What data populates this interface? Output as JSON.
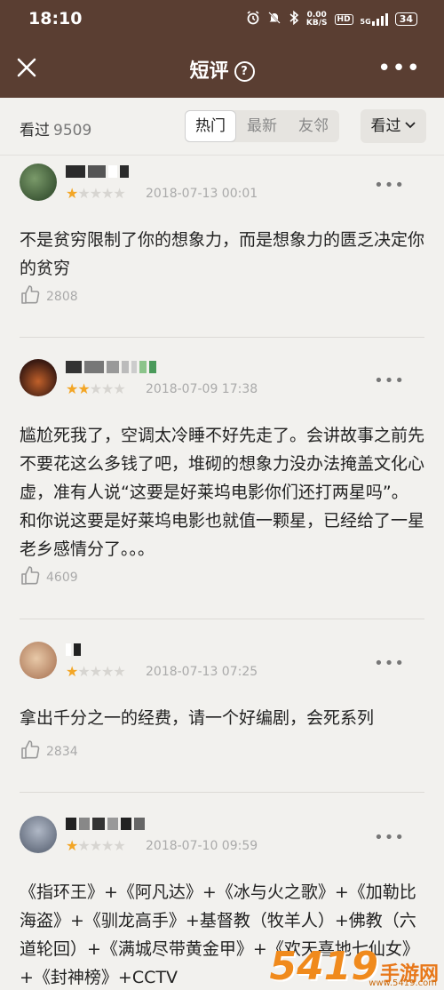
{
  "status_bar": {
    "time": "18:10",
    "speed_value": "0.00",
    "speed_unit": "KB/S",
    "hd": "HD",
    "network": "5G",
    "battery": "34"
  },
  "header": {
    "title": "短评",
    "help_icon": "question-circle-icon",
    "close_icon": "close-icon",
    "more_icon": "more-horizontal-icon",
    "more_glyph": "•••"
  },
  "filter_bar": {
    "seen_label": "看过",
    "seen_count": "9509",
    "tabs": [
      {
        "label": "热门",
        "active": true
      },
      {
        "label": "最新",
        "active": false
      },
      {
        "label": "友邻",
        "active": false
      }
    ],
    "seen_filter_label": "看过"
  },
  "reviews": [
    {
      "rating": 1,
      "date": "2018-07-13 00:01",
      "text": "不是贫穷限制了你的想象力，而是想象力的匮乏决定你的贫穷",
      "likes": "2808"
    },
    {
      "rating": 2,
      "date": "2018-07-09 17:38",
      "text": "尴尬死我了，空调太冷睡不好先走了。会讲故事之前先不要花这么多钱了吧，堆砌的想象力没办法掩盖文化心虚，准有人说“这要是好莱坞电影你们还打两星吗”。和你说这要是好莱坞电影也就值一颗星，已经给了一星老乡感情分了。。。",
      "likes": "4609"
    },
    {
      "rating": 1,
      "date": "2018-07-13 07:25",
      "text": "拿出千分之一的经费，请一个好编剧，会死系列",
      "likes": "2834"
    },
    {
      "rating": 1,
      "date": "2018-07-10 09:59",
      "text": "《指环王》+《阿凡达》+《冰与火之歌》+《加勒比海盗》+《驯龙高手》+基督教（牧羊人）+佛教（六道轮回）+《满城尽带黄金甲》+《欢天喜地七仙女》+《封神榜》+CCTV",
      "likes": ""
    }
  ],
  "watermark": {
    "number": "5419",
    "text": "手游网",
    "url": "www.5419.com"
  },
  "colors": {
    "header_bg": "#5a3e32",
    "star_on": "#f3a626",
    "star_off": "#d7d5d1",
    "page_bg": "#f2f1ee"
  }
}
